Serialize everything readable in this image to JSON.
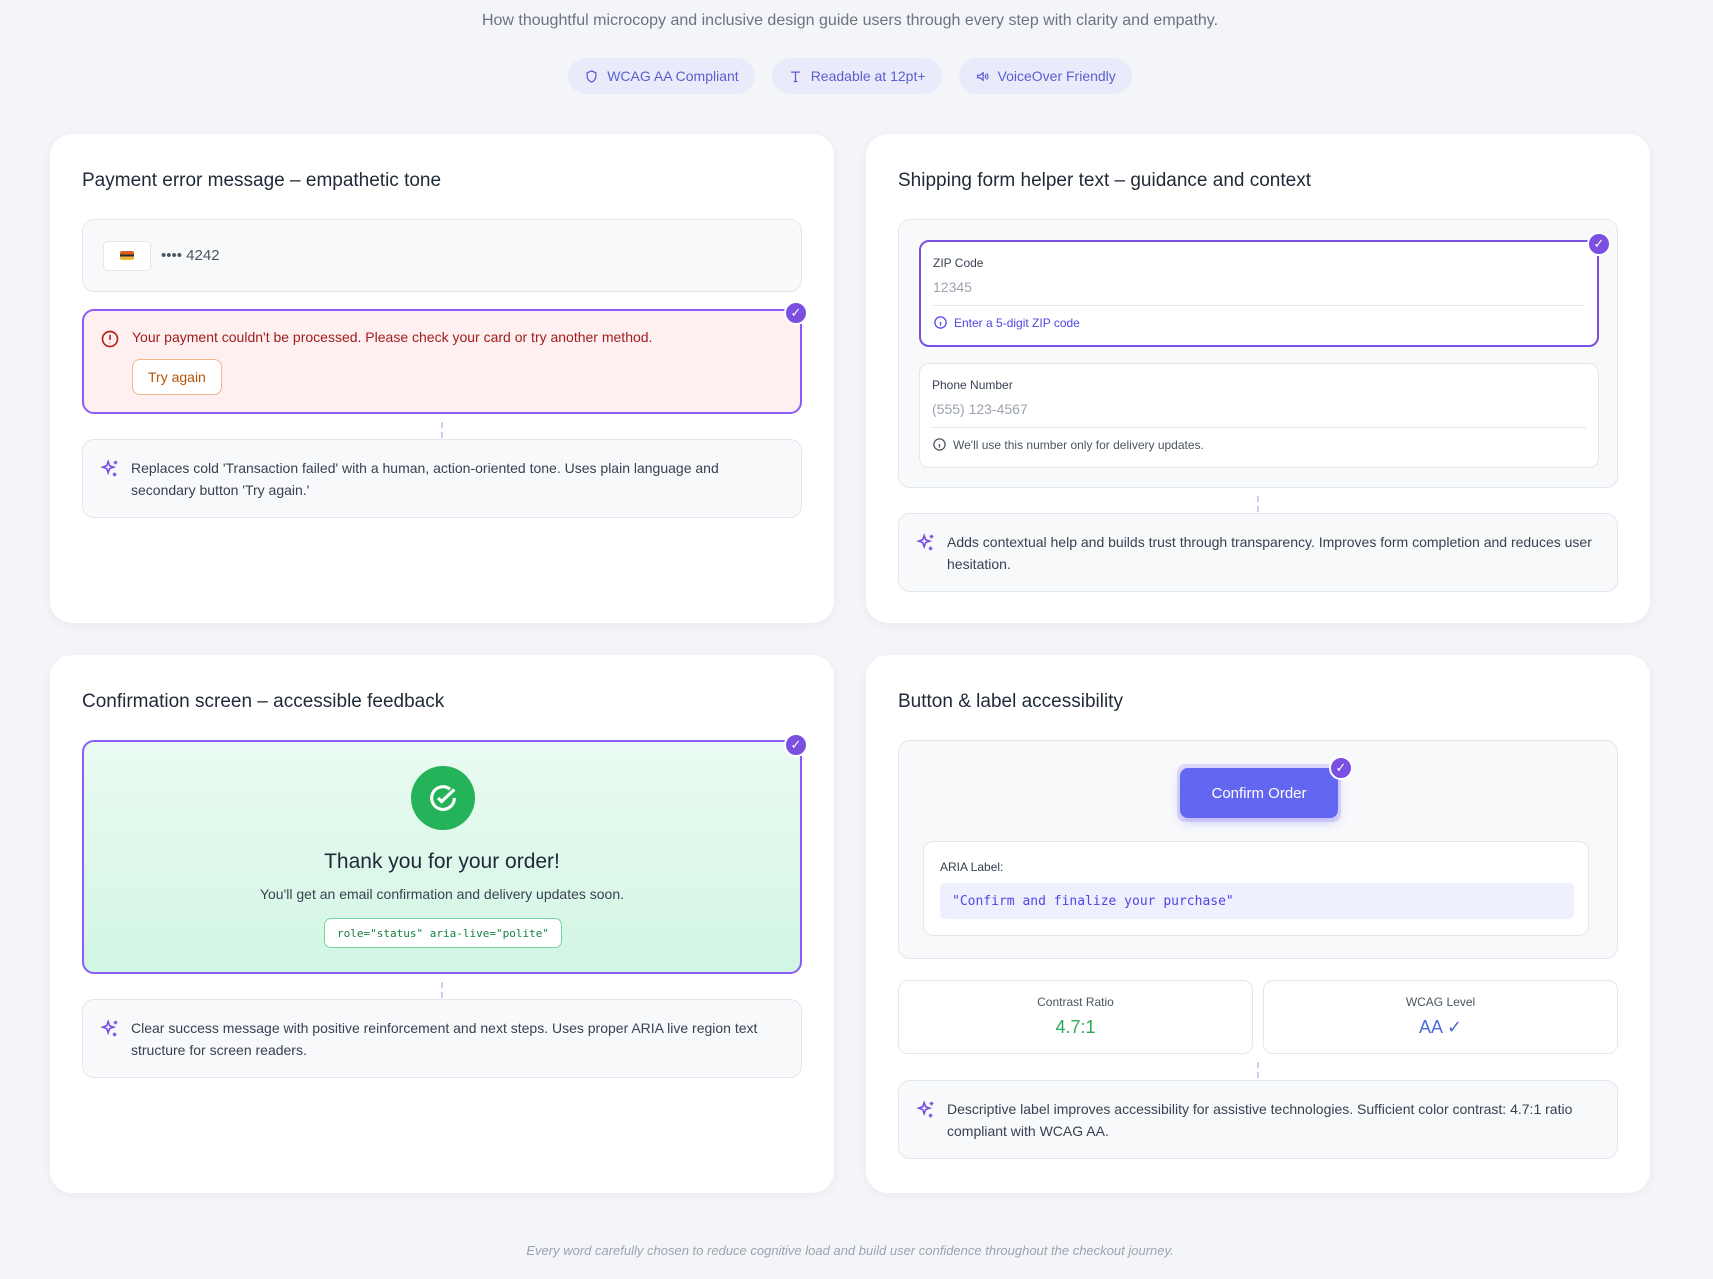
{
  "header": {
    "subtitle": "How thoughtful microcopy and inclusive design guide users through every step with clarity and empathy."
  },
  "badges": [
    {
      "icon": "shield-icon",
      "label": "WCAG AA Compliant"
    },
    {
      "icon": "text-icon",
      "label": "Readable at 12pt+"
    },
    {
      "icon": "speaker-icon",
      "label": "VoiceOver Friendly"
    }
  ],
  "payment_card": {
    "title": "Payment error message – empathetic tone",
    "card_number": "•••• 4242",
    "error_message": "Your payment couldn't be processed. Please check your card or try another method.",
    "retry_label": "Try again",
    "note": "Replaces cold 'Transaction failed' with a human, action-oriented tone. Uses plain language and secondary button 'Try again.'"
  },
  "shipping_card": {
    "title": "Shipping form helper text – guidance and context",
    "zip": {
      "label": "ZIP Code",
      "placeholder": "12345",
      "helper": "Enter a 5-digit ZIP code"
    },
    "phone": {
      "label": "Phone Number",
      "placeholder": "(555) 123-4567",
      "helper": "We'll use this number only for delivery updates."
    },
    "note": "Adds contextual help and builds trust through transparency. Improves form completion and reduces user hesitation."
  },
  "confirmation_card": {
    "title": "Confirmation screen – accessible feedback",
    "heading": "Thank you for your order!",
    "message": "You'll get an email confirmation and delivery updates soon.",
    "code": "role=\"status\" aria-live=\"polite\"",
    "note": "Clear success message with positive reinforcement and next steps. Uses proper ARIA live region text structure for screen readers."
  },
  "button_card": {
    "title": "Button & label accessibility",
    "button_label": "Confirm Order",
    "aria_caption": "ARIA Label:",
    "aria_value": "\"Confirm and finalize your purchase\"",
    "stats": [
      {
        "label": "Contrast Ratio",
        "value": "4.7:1",
        "color": "#2fa85a"
      },
      {
        "label": "WCAG Level",
        "value": "AA ✓",
        "color": "#4f6bdc"
      }
    ],
    "note": "Descriptive label improves accessibility for assistive technologies. Sufficient color contrast: 4.7:1 ratio compliant with WCAG AA."
  },
  "footer": {
    "text": "Every word carefully chosen to reduce cognitive load and build user confidence throughout the checkout journey."
  },
  "colors": {
    "accent": "#7b4fe0",
    "primary_button": "#6366f1",
    "error_text": "#a11d1d",
    "success": "#25b35a",
    "badge_text": "#5a5fcf"
  }
}
